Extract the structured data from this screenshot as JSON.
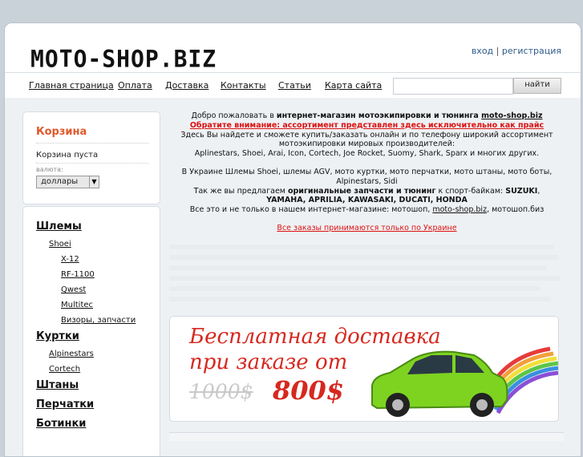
{
  "header": {
    "logo": "MOTO-SHOP.BIZ",
    "login": "вход",
    "separator": "|",
    "register": "регистрация"
  },
  "nav": {
    "items": [
      "Главная страница",
      "Оплата",
      "Доставка",
      "Контакты",
      "Статьи",
      "Карта сайта"
    ],
    "search_placeholder": "",
    "search_button": "найти"
  },
  "cart": {
    "title": "Корзина",
    "empty": "Корзина пуста",
    "currency_label": "валюта:",
    "currency_value": "доллары"
  },
  "categories": {
    "helmets": "Шлемы",
    "shoei": "Shoei",
    "x12": "X-12",
    "rf1100": "RF-1100",
    "qwest": "Qwest",
    "multitec": "Multitec",
    "visors": "Визоры, запчасти",
    "jackets": "Куртки",
    "alpinestars": "Alpinestars",
    "cortech": "Cortech",
    "pants": "Штаны",
    "gloves": "Перчатки",
    "boots": "Ботинки"
  },
  "welcome": {
    "l1_a": "Добро пожаловать в ",
    "l1_b": "интернет-магазин мотоэкипировки и тюнинга ",
    "l1_c": "moto-shop.biz",
    "l2": "Обратите внимание: ассортимент представлен здесь исключительно как прайс",
    "l3": "Здесь Вы найдете и сможете купить/заказать онлайн и по телефону широкий ассортимент",
    "l4": "мотоэкипировки мировых производителей:",
    "l5": "Aplinestars, Shoei, Arai, Icon, Cortech, Joe Rocket, Suomy, Shark, Sparx и многих других.",
    "l6": "В Украине Шлемы Shoei, шлемы AGV, мото куртки, мото перчатки, мото штаны, мото боты,",
    "l7": "Alpinestars, Sidi",
    "l8_a": "Так же вы предлагаем ",
    "l8_b": "оригинальные запчасти и тюнинг",
    "l8_c": " к спорт-байкам: ",
    "l8_d": "SUZUKI",
    "l8_e": ",",
    "l9": "YAMAHA, APRILIA, KAWASAKI, DUCATI, HONDA",
    "l10_a": "Все это и не только в нашем интернет-магазине: мотошоп, ",
    "l10_b": "moto-shop.biz",
    "l10_c": ", мотошоп.биз",
    "orders": "Все заказы принимаются только по Украине"
  },
  "banner": {
    "line1": "Бесплатная доставка",
    "line2": "при заказе от",
    "old_price": "1000$",
    "new_price": "800$"
  },
  "colors": {
    "accent_orange": "#e0582b",
    "banner_red": "#d6281f",
    "link_blue": "#2b5a8a"
  }
}
